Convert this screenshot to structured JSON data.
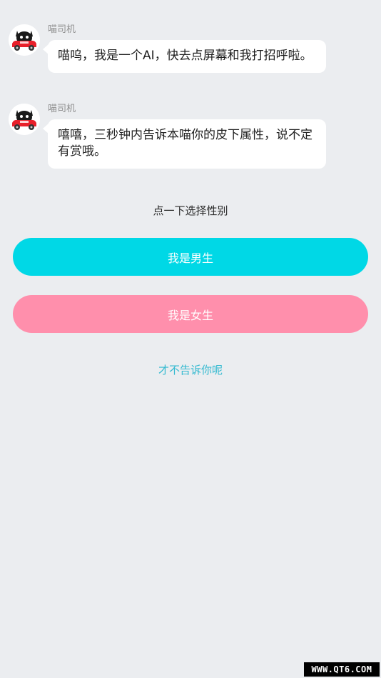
{
  "messages": [
    {
      "sender": "喵司机",
      "text": "喵呜，我是一个AI，快去点屏幕和我打招呼啦。",
      "avatar_icon": "cat-driving-red-car-icon"
    },
    {
      "sender": "喵司机",
      "text": "嘻嘻，三秒钟内告诉本喵你的皮下属性，说不定有赏哦。",
      "avatar_icon": "cat-driving-red-car-icon"
    }
  ],
  "prompt": "点一下选择性别",
  "buttons": {
    "male": "我是男生",
    "female": "我是女生",
    "skip": "才不告诉你呢"
  },
  "watermark": "WWW.QT6.COM",
  "colors": {
    "background": "#ebedf0",
    "male_button": "#00d8e6",
    "female_button": "#ff8fac",
    "skip_link": "#32b9d0",
    "bubble": "#ffffff"
  }
}
